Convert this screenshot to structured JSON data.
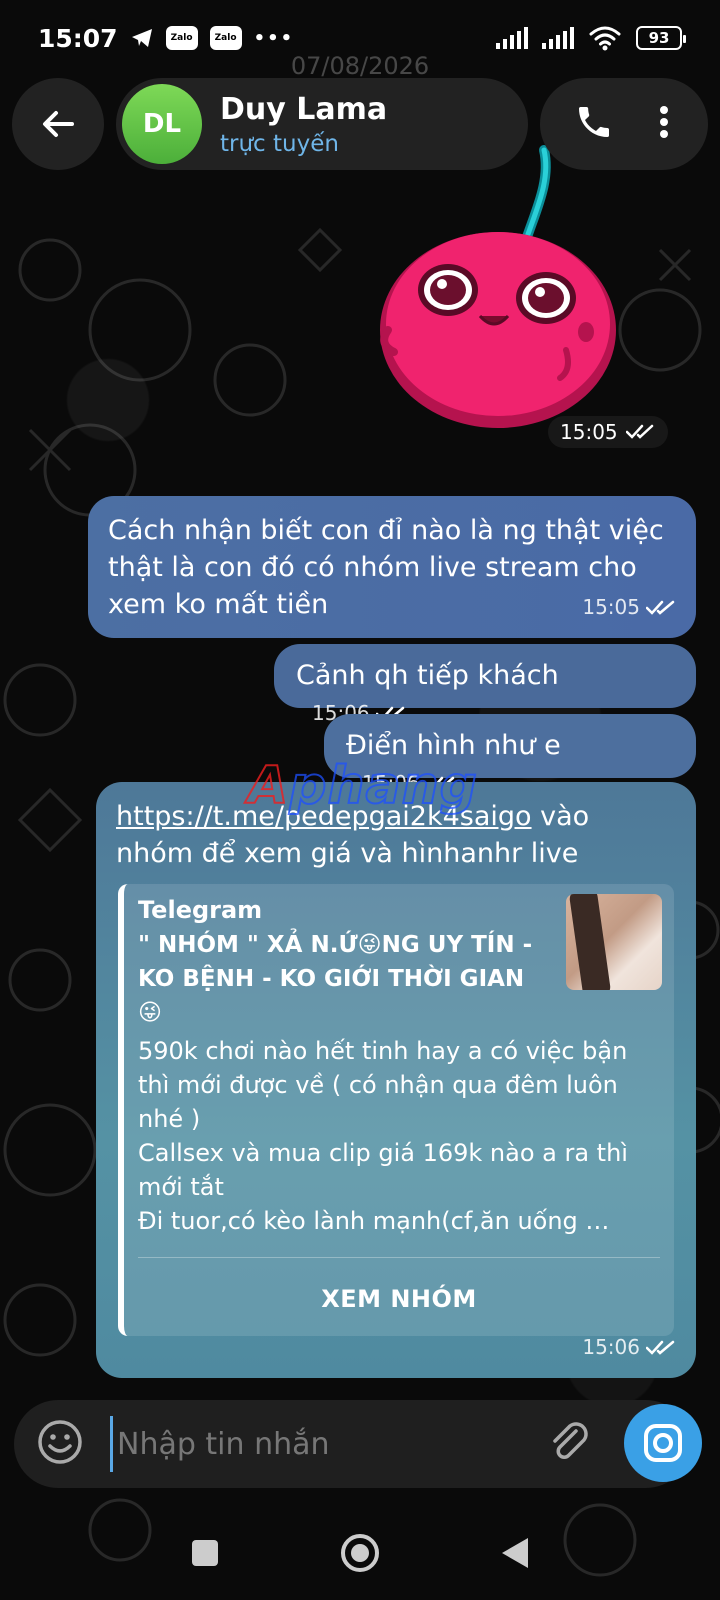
{
  "status_bar": {
    "time": "15:07",
    "zalo_1": "Zalo",
    "zalo_2": "Zalo",
    "more": "•••",
    "battery": "93"
  },
  "date_chip": "07/08/2026",
  "header": {
    "avatar_initials": "DL",
    "contact_name": "Duy Lama",
    "contact_status": "trực tuyến"
  },
  "sticker": {
    "time": "15:05"
  },
  "messages": [
    {
      "text": "Cách nhận biết con đỉ nào là ng thật việc thật là con đó có nhóm live stream cho xem ko mất tiền",
      "time": "15:05"
    },
    {
      "text": "Cảnh qh tiếp khách",
      "time": "15:06"
    },
    {
      "text": "Điển hình như e",
      "time": "15:06"
    }
  ],
  "link_message": {
    "link": "https://t.me/pedepgai2k4saigo",
    "text_after": " vào nhóm để xem giá và hìnhanhr live",
    "time": "15:06",
    "preview": {
      "site": "Telegram",
      "title": "\" NHÓM \" XẢ N.Ứ😜NG UY TÍN - KO BỆNH - KO GIỚI THỜI GIAN 😜",
      "description_1": "590k chơi nào hết tinh hay a có việc bận thì mới được về ( có nhận qua đêm luôn nhé )",
      "description_2": "Callsex và mua clip giá 169k nào a ra thì mới tắt",
      "description_3": "Đi tuor,có kèo lành mạnh(cf,ăn uống …",
      "button": "XEM NHÓM"
    }
  },
  "watermark": {
    "part1": "A",
    "part2": "phang"
  },
  "input": {
    "placeholder": "Nhập tin nhắn"
  },
  "icons": {
    "back": "arrow-left-icon",
    "call": "phone-icon",
    "more": "more-vertical-icon",
    "emoji": "emoji-icon",
    "attach": "paperclip-icon",
    "camera": "camera-icon",
    "read": "double-check-icon"
  }
}
